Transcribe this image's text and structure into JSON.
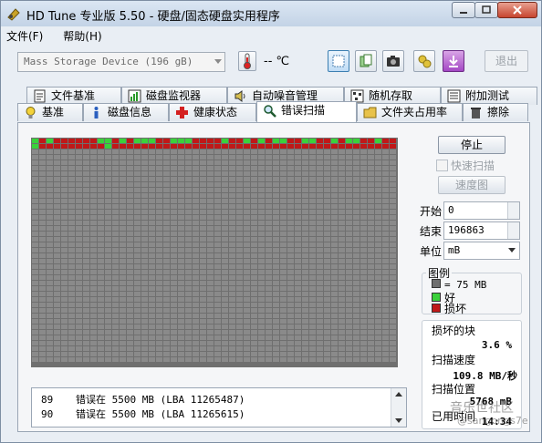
{
  "window": {
    "title": "HD Tune 专业版 5.50 - 硬盘/固态硬盘实用程序"
  },
  "menu": {
    "file": "文件(F)",
    "help": "帮助(H)"
  },
  "toolbar": {
    "device": "Mass   Storage Device (196 gB)",
    "temperature": "-- ℃",
    "exit_label": "退出"
  },
  "tabs_top": [
    {
      "label": "文件基准",
      "icon": "file-benchmark-icon"
    },
    {
      "label": "磁盘监视器",
      "icon": "disk-monitor-icon"
    },
    {
      "label": "自动噪音管理",
      "icon": "speaker-icon"
    },
    {
      "label": "随机存取",
      "icon": "random-access-icon"
    },
    {
      "label": "附加测试",
      "icon": "extra-tests-icon"
    }
  ],
  "tabs_bottom": [
    {
      "label": "基准",
      "icon": "lightbulb-icon"
    },
    {
      "label": "磁盘信息",
      "icon": "info-icon"
    },
    {
      "label": "健康状态",
      "icon": "health-cross-icon"
    },
    {
      "label": "错误扫描",
      "icon": "magnifier-icon",
      "active": true
    },
    {
      "label": "文件夹占用率",
      "icon": "folder-icon"
    },
    {
      "label": "擦除",
      "icon": "trash-icon"
    }
  ],
  "controls": {
    "stop_label": "停止",
    "quick_scan_label": "快速扫描",
    "speed_map_label": "速度图",
    "start_label": "开始",
    "start_value": "0",
    "end_label": "结束",
    "end_value": "196863",
    "unit_label": "单位",
    "unit_value": "mB"
  },
  "legend": {
    "title": "图例",
    "block_size": "= 75 MB",
    "good": "好",
    "damaged": "损坏",
    "colors": {
      "unscanned": "#6f6f6f",
      "good": "#3bd13b",
      "damaged": "#c01818"
    }
  },
  "stats": {
    "damaged_blocks_label": "损坏的块",
    "damaged_blocks_value": "3.6 %",
    "scan_speed_label": "扫描速度",
    "scan_speed_value": "109.8 MB/秒",
    "scan_position_label": "扫描位置",
    "scan_position_value": "5768 mB",
    "elapsed_label": "已用时间",
    "elapsed_value": "14:34"
  },
  "log": [
    {
      "num": "89",
      "text": "错误在 5500 MB (LBA 11265487)"
    },
    {
      "num": "90",
      "text": "错误在 5500 MB (LBA 11265615)"
    }
  ],
  "scan_map": {
    "cols": 50,
    "rows": 41,
    "scanned_row0": "GRGRRRRRRGGRGRGGGRRGGGRRRRGRRGRGRGGRRGGRRGRGGRRGRR",
    "scanned_row1": "GRRRRRRRRRGRRRRRRRRRRRRRRRRRRRRRRRRRRRRRRRRRRRRRRR"
  },
  "watermark": {
    "line1": "音乐世社区",
    "line2": "@sangongs7e"
  }
}
